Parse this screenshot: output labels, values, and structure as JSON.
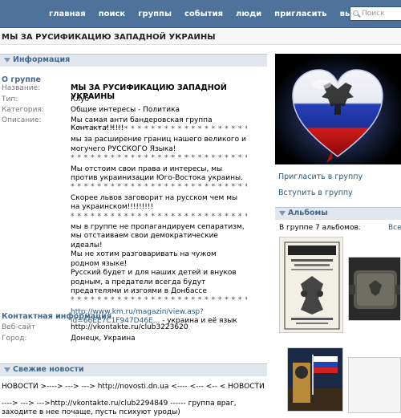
{
  "nav": {
    "items": [
      "главная",
      "поиск",
      "группы",
      "события",
      "люди",
      "пригласить",
      "выйти"
    ],
    "search_placeholder": "Поиск"
  },
  "page": {
    "title": "МЫ ЗА РУСИФИКАЦИЮ ЗАПАДНОЙ УКРАИНЫ"
  },
  "info": {
    "header": "Информация",
    "about_header": "О группе",
    "fields": [
      {
        "label": "Название:",
        "value": "МЫ ЗА РУСИФИКАЦИЮ ЗАПАДНОЙ УКРАИНЫ"
      },
      {
        "label": "Тип:",
        "value": "Клуб"
      },
      {
        "label": "Категория:",
        "value": "Общие интересы - Политика"
      },
      {
        "label": "Описание:",
        "value": "Мы самая анти бандеровская группа Контакта!!!!!!"
      }
    ],
    "description": [
      "* * * * * * * * * * * * * * * * * * * * * * * * * * * * * * * * *",
      "мы за расширение границ нашего великого и могучего РУССКОГО Языка!",
      "* * * * * * * * * * * * * * * * * * * * * * * * * * * * * * * * *",
      "Мы отстоим свои права и интересы, мы против украинизации Юго-Востока украины.",
      "* * * * * * * * * * * * * * * * * * * * * * * * * * * * * * * * *",
      "Скорее львов заговорит на русском чем мы на украинском!!!!!!!!!",
      "* * * * * * * * * * * * * * * * * * * * * * * * * * * * * * * * *",
      "мы в группе не пропагандируем сепаратизм, мы отстаиваем свои демократические идеалы!",
      "Мы не хотим разговаривать на чужом родном языке!",
      "Русский будет и для наших детей и внуков родным, а предатели всегда будут предателями и изгоями в Донбассе",
      "* * * * * * * * * * * * * * * * * * * * * * * * * * * * * * * * *"
    ],
    "link_url": "http://www.km.ru/magazin/view.asp?id=66EE7C1F947D46E...",
    "link_suffix": " - украина и её язык",
    "contact_header": "Контактная информация",
    "website_label": "Веб-сайт",
    "website_value": "http://vkontakte.ru/club3223620",
    "city_label": "Город:",
    "city_value": "Донецк, Украина"
  },
  "news": {
    "header": "Свежие новости",
    "line1": "НОВОСТИ >----> ---> ---> http://novosti.dn.ua <---- <--- <-- < НОВОСТИ",
    "line2_prefix": "---->",
    "line2_rest": " ---> --->http://vkontakte.ru/club2294849 ------ группа враг, заходите в нее почаще, пусть психуют уроды)"
  },
  "sidebar": {
    "invite": "Пригласить в группу",
    "join": "Вступить в группу",
    "albums_header": "Альбомы",
    "albums_count": "В группе 7 альбомов.",
    "albums_link": "Все"
  },
  "colors": {
    "nav_bg": "#4e729a",
    "section_bg": "#e1e7ed",
    "link": "#2b587a",
    "header_text": "#45688e"
  }
}
